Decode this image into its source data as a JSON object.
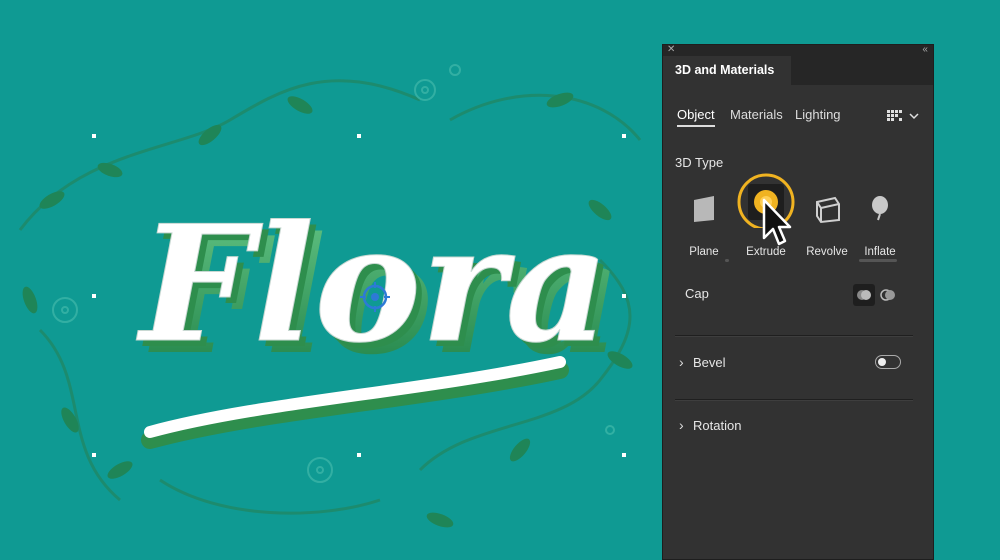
{
  "artwork": {
    "word": "Flora"
  },
  "panel": {
    "title": "3D and Materials",
    "subtabs": [
      "Object",
      "Materials",
      "Lighting"
    ],
    "active_subtab": "Object",
    "section_3d_type": "3D Type",
    "types": [
      {
        "label": "Plane",
        "icon": "plane-icon"
      },
      {
        "label": "Extrude",
        "icon": "extrude-icon",
        "selected": true
      },
      {
        "label": "Revolve",
        "icon": "revolve-icon"
      },
      {
        "label": "Inflate",
        "icon": "inflate-icon"
      }
    ],
    "cap_label": "Cap",
    "bevel_label": "Bevel",
    "bevel_enabled": false,
    "rotation_label": "Rotation"
  },
  "colors": {
    "canvas_bg": "#0f9a93",
    "panel_bg": "#323232",
    "highlight": "#f0b321",
    "lettering_green": "#2e8e4d"
  }
}
